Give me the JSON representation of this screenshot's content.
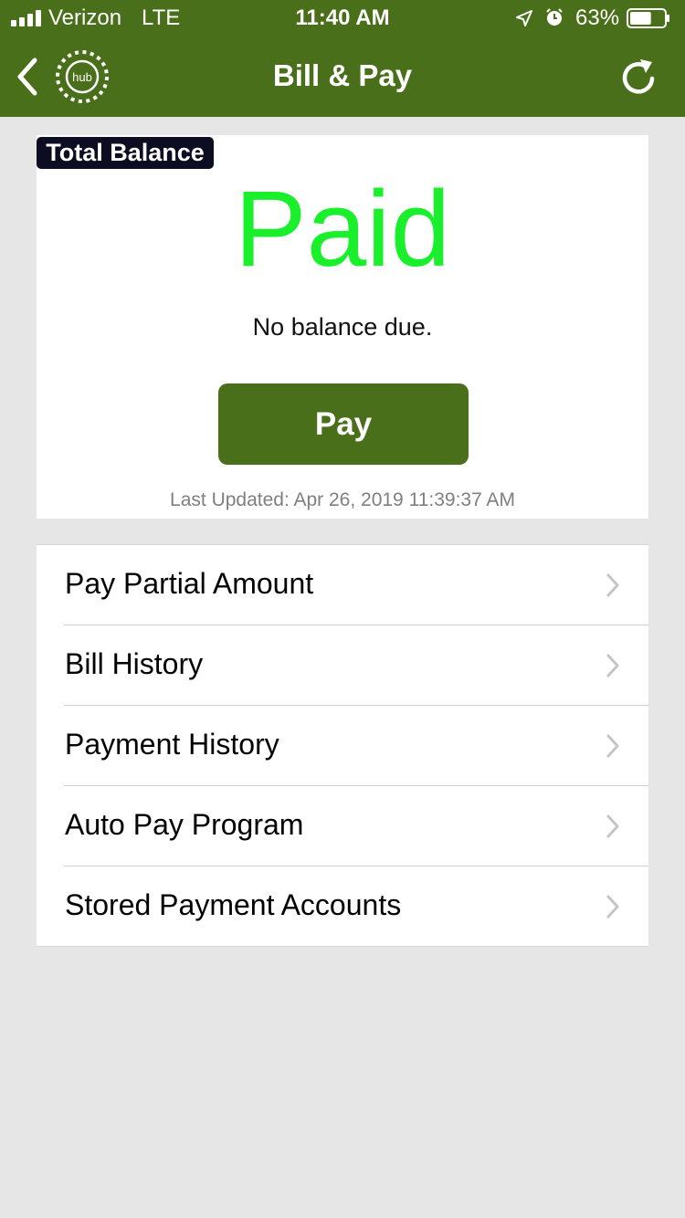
{
  "status_bar": {
    "carrier": "Verizon",
    "network": "LTE",
    "time": "11:40 AM",
    "battery_percent": "63%",
    "battery_level": 0.63,
    "icons": [
      "signal-icon",
      "location-arrow-icon",
      "alarm-clock-icon",
      "battery-icon"
    ]
  },
  "nav": {
    "title": "Bill & Pay",
    "logo_text": "hub",
    "back_icon": "chevron-left-icon",
    "refresh_icon": "refresh-icon"
  },
  "balance": {
    "badge": "Total Balance",
    "status": "Paid",
    "message": "No balance due.",
    "pay_button": "Pay",
    "last_updated": "Last Updated: Apr 26, 2019 11:39:37 AM"
  },
  "menu": {
    "items": [
      {
        "label": "Pay Partial Amount"
      },
      {
        "label": "Bill History"
      },
      {
        "label": "Payment History"
      },
      {
        "label": "Auto Pay Program"
      },
      {
        "label": "Stored Payment Accounts"
      }
    ],
    "chevron_icon": "chevron-right-icon"
  },
  "colors": {
    "header_green": "#4a6f1a",
    "paid_green": "#19f02b",
    "badge_bg": "#0c0c22",
    "page_bg": "#e6e6e6"
  }
}
